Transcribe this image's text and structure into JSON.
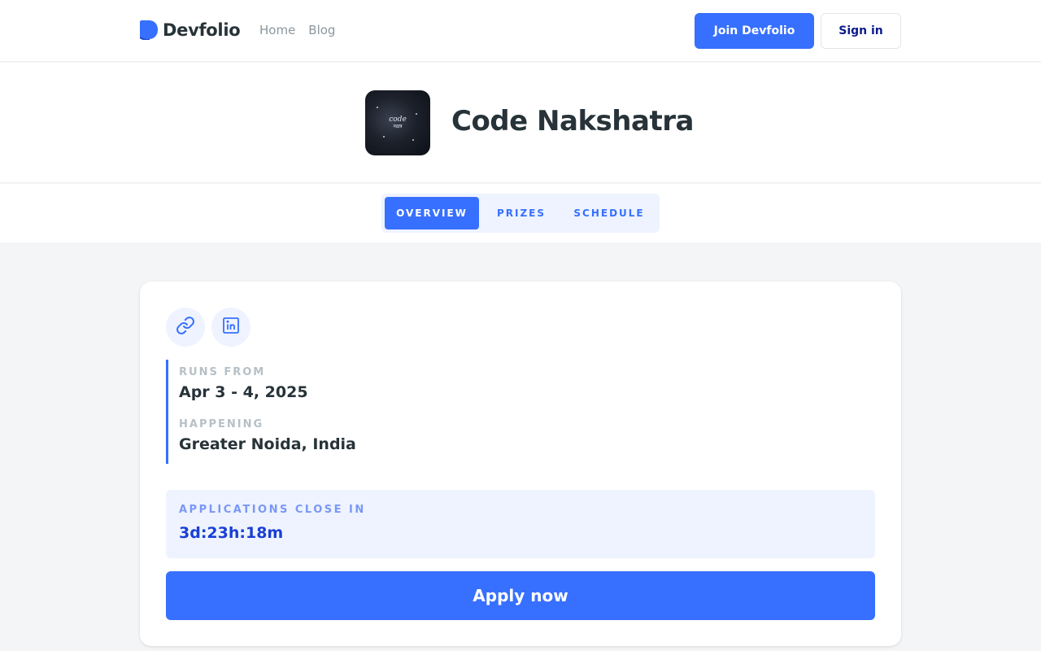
{
  "header": {
    "brand": "Devfolio",
    "nav": [
      {
        "label": "Home"
      },
      {
        "label": "Blog"
      }
    ],
    "join_label": "Join Devfolio",
    "signin_label": "Sign in"
  },
  "hackathon": {
    "name": "Code Nakshatra",
    "logo_text_line1": "code",
    "logo_text_line2": "नक्षत्र"
  },
  "tabs": [
    {
      "label": "OVERVIEW",
      "active": true
    },
    {
      "label": "PRIZES",
      "active": false
    },
    {
      "label": "SCHEDULE",
      "active": false
    }
  ],
  "overview": {
    "links": [
      {
        "icon": "link-icon"
      },
      {
        "icon": "linkedin-icon"
      }
    ],
    "runs_from_label": "RUNS FROM",
    "runs_from_value": "Apr 3 - 4, 2025",
    "happening_label": "HAPPENING",
    "happening_value": "Greater Noida, India",
    "deadline_label": "APPLICATIONS CLOSE IN",
    "deadline_value": "3d:23h:18m",
    "apply_label": "Apply now"
  },
  "colors": {
    "accent": "#3770ff",
    "accent_light": "#eef3ff",
    "text_dark": "#273339",
    "text_muted": "#b6c0c6"
  }
}
